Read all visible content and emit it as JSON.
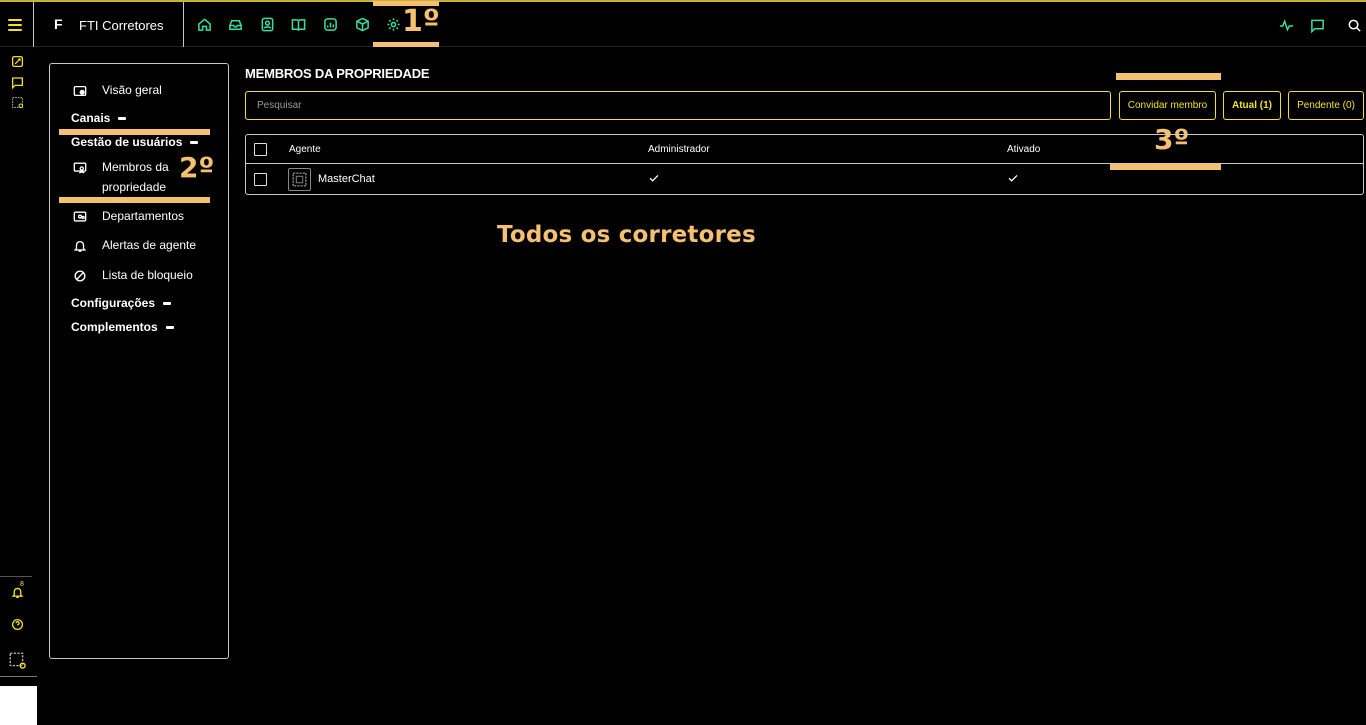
{
  "header": {
    "brand_letter": "F",
    "brand_name": "FTI Corretores",
    "nav_icons": [
      "home-icon",
      "inbox-icon",
      "contacts-icon",
      "book-icon",
      "reports-icon",
      "box-icon",
      "settings-icon"
    ],
    "right_icons": [
      "activity-icon",
      "chat-icon",
      "search-icon"
    ]
  },
  "rail": {
    "icons": [
      "edit-card-icon",
      "chat-icon",
      "puzzle-icon",
      "bell-icon",
      "help-icon",
      "puzzle-icon"
    ],
    "notification_count": "8"
  },
  "sidebar": {
    "items": [
      {
        "label": "Visão geral"
      },
      {
        "label": "Membros da propriedade"
      },
      {
        "label": "Departamentos"
      },
      {
        "label": "Alertas de agente"
      },
      {
        "label": "Lista de bloqueio"
      }
    ],
    "sections": [
      {
        "label": "Canais"
      },
      {
        "label": "Gestão de usuários"
      },
      {
        "label": "Configurações"
      },
      {
        "label": "Complementos"
      }
    ]
  },
  "main": {
    "title": "MEMBROS DA PROPRIEDADE",
    "search_placeholder": "Pesquisar",
    "buttons": {
      "invite": "Convidar membro",
      "current": "Atual (1)",
      "pending": "Pendente (0)"
    },
    "table": {
      "columns": [
        "Agente",
        "Administrador",
        "Ativado"
      ],
      "rows": [
        {
          "agent": "MasterChat",
          "admin": true,
          "enabled": true
        }
      ]
    }
  },
  "annotations": {
    "step1": "1º",
    "step2": "2º",
    "step3": "3º",
    "caption": "Todos os corretores"
  },
  "colors": {
    "accent": "#f2e12a",
    "annotation": "#f5c06f",
    "background": "#000000"
  }
}
